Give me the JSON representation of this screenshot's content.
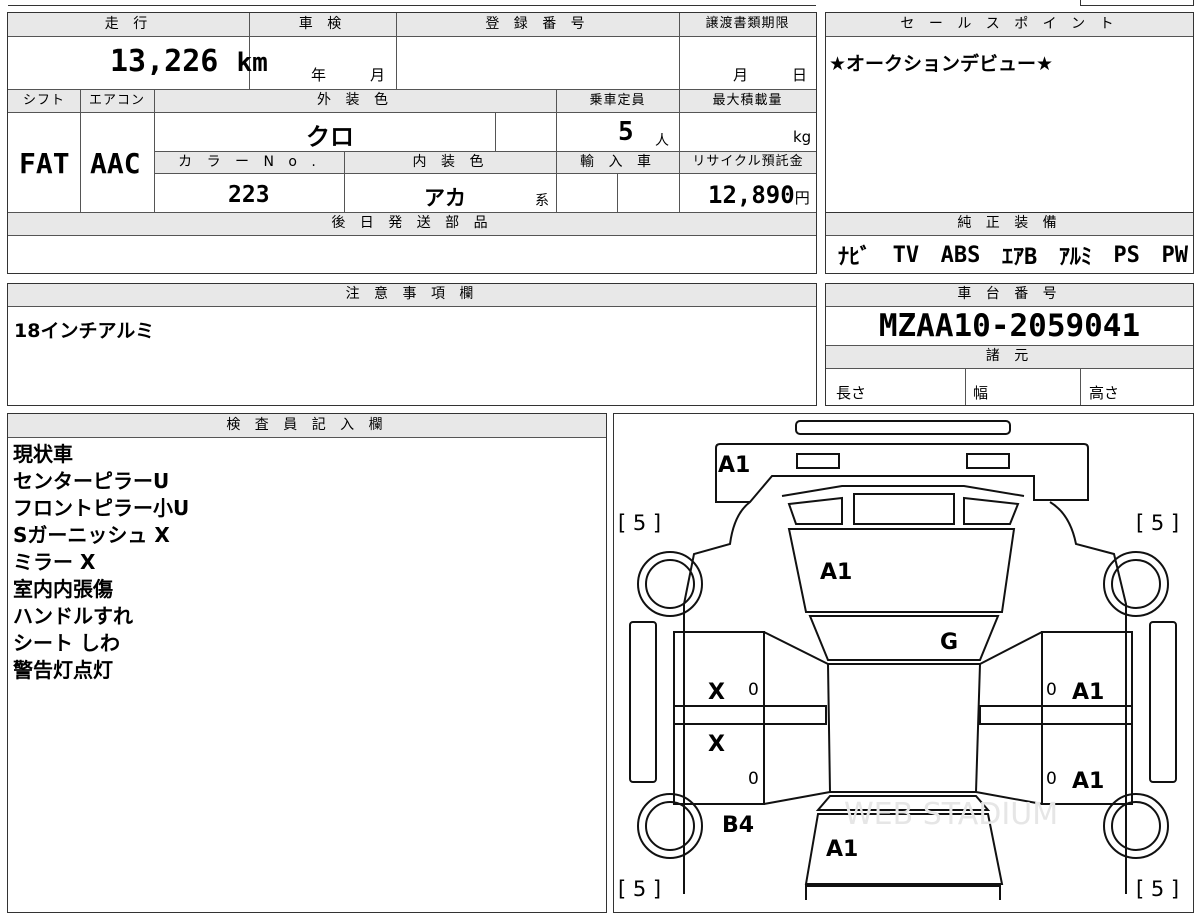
{
  "header": {
    "mileage_label": "走 行",
    "mileage_value": "13,226",
    "mileage_unit": "km",
    "inspection_label": "車 検",
    "inspection_year": "年",
    "inspection_month": "月",
    "registration_label": "登 録 番 号",
    "transfer_label": "譲渡書類期限",
    "transfer_month": "月",
    "transfer_day": "日"
  },
  "sales_point": {
    "label": "セ ー ル ス ポ イ ン ト",
    "text": "★オークションデビュー★"
  },
  "specs": {
    "shift_label": "シフト",
    "shift_value": "FAT",
    "ac_label": "エアコン",
    "ac_value": "AAC",
    "exterior_label": "外 装 色",
    "exterior_value": "クロ",
    "capacity_label": "乗車定員",
    "capacity_value": "5",
    "capacity_unit": "人",
    "maxload_label": "最大積載量",
    "maxload_unit": "kg",
    "color_no_label": "カ ラ ー N o .",
    "color_no_value": "223",
    "interior_label": "内 装 色",
    "interior_value": "アカ",
    "interior_unit": "系",
    "import_label": "輸 入 車",
    "recycle_label": "リサイクル預託金",
    "recycle_value": "12,890",
    "recycle_unit": "円"
  },
  "later_parts": {
    "label": "後 日 発 送 部 品"
  },
  "equipment": {
    "label": "純 正 装 備",
    "items": [
      "ﾅﾋﾞ",
      "TV",
      "ABS",
      "ｴｱB",
      "ｱﾙﾐ",
      "PS",
      "PW"
    ]
  },
  "caution": {
    "label": "注 意 事 項 欄",
    "text": "18インチアルミ"
  },
  "chassis": {
    "label": "車 台 番 号",
    "value": "MZAA10-2059041",
    "specs_label": "諸 元",
    "length_label": "長さ",
    "width_label": "幅",
    "height_label": "高さ"
  },
  "inspector": {
    "label": "検 査 員 記 入 欄",
    "notes": [
      "現状車",
      "センターピラーU",
      "フロントピラー小U",
      "Sガーニッシュ X",
      "ミラー X",
      "室内内張傷",
      "ハンドルすれ",
      "シート しわ",
      "警告灯点灯"
    ]
  },
  "diagram": {
    "marks": {
      "front_bumper": "A1",
      "hood": "A1",
      "roof": "G",
      "front_left_door": "X",
      "rear_left_door": "X",
      "front_right_door": "A1",
      "rear_right_door": "A1",
      "rear_left_fender": "B4",
      "trunk": "A1",
      "front_left_tire": "[ 5 ]",
      "front_right_tire": "[ 5 ]",
      "rear_left_tire": "[ 5 ]",
      "rear_right_tire": "[ 5 ]",
      "left_front_handle": "0",
      "left_rear_handle": "0",
      "right_front_handle": "0",
      "right_rear_handle": "0"
    },
    "watermark": "WEB STADIUM"
  }
}
